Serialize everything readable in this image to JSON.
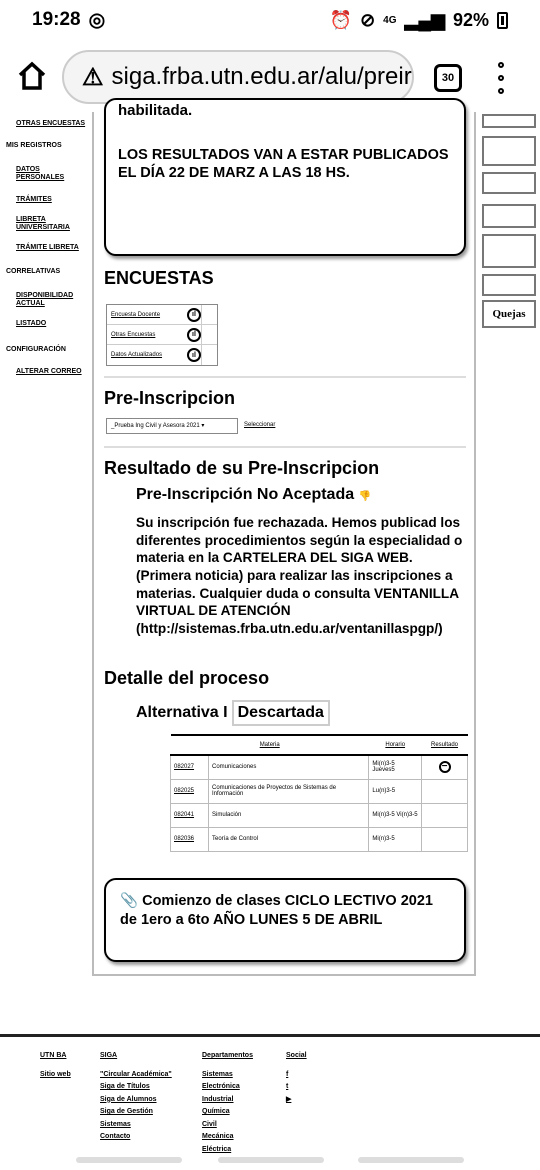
{
  "status": {
    "time": "19:28",
    "battery": "92%",
    "signal": "4G"
  },
  "browser": {
    "url": "siga.frba.utn.edu.ar/alu/preir",
    "tab_count": "30"
  },
  "sidebar": {
    "items": [
      {
        "label": "OTRAS ENCUESTAS"
      },
      {
        "label": "MIS REGISTROS"
      },
      {
        "label": "DATOS PERSONALES"
      },
      {
        "label": "TRÁMITES"
      },
      {
        "label": "LIBRETA UNIVERSITARIA"
      },
      {
        "label": "TRÁMITE LIBRETA"
      },
      {
        "label": "CORRELATIVAS"
      },
      {
        "label": "DISPONIBILIDAD ACTUAL"
      },
      {
        "label": "LISTADO"
      },
      {
        "label": "CONFIGURACIÓN"
      },
      {
        "label": "ALTERAR CORREO"
      }
    ]
  },
  "notice": {
    "top_line": "habilitada.",
    "results": "LOS RESULTADOS VAN A ESTAR PUBLICADOS EL DÍA 22 DE MARZ A LAS 18 HS."
  },
  "encuestas": {
    "title": "ENCUESTAS",
    "rows": [
      "Encuesta Docente",
      "Otras Encuestas",
      "Datos Actualizados"
    ]
  },
  "preinscripcion": {
    "title": "Pre-Inscripcion",
    "select_value": "_Prueba Ing Civil y Asesora 2021",
    "select_link": "Seleccionar"
  },
  "resultado": {
    "title": "Resultado de su Pre-Inscripcion",
    "status_title": "Pre-Inscripción No Aceptada",
    "body": "Su inscripción fue rechazada. Hemos publicad los diferentes procedimientos según la especialidad o materia en la CARTELERA DEL SIGA WEB. (Primera noticia) para realizar las inscripciones a materias. Cualquier duda o consulta VENTANILLA VIRTUAL DE ATENCIÓN (http://sistemas.frba.utn.edu.ar/ventanillaspgp/)"
  },
  "detalle": {
    "title": "Detalle del proceso",
    "alt_label": "Alternativa I",
    "alt_status": "Descartada",
    "table": {
      "headers": [
        "Materia",
        "Horario",
        "Resultado"
      ],
      "rows": [
        {
          "code": "082027",
          "name": "Comunicaciones",
          "schedule": "Mi(n)3-5 Jueves5",
          "result": "−"
        },
        {
          "code": "082025",
          "name": "Comunicaciones de Proyectos de Sistemas de Información",
          "schedule": "Lu(n)3-5",
          "result": ""
        },
        {
          "code": "082041",
          "name": "Simulación",
          "schedule": "Mi(n)3-5 Vi(n)3-5",
          "result": ""
        },
        {
          "code": "082036",
          "name": "Teoría de Control",
          "schedule": "Mi(n)3-5",
          "result": ""
        }
      ]
    }
  },
  "clases": {
    "text": "Comienzo de clases CICLO LECTIVO 2021 de 1ero a 6to AÑO LUNES 5 DE ABRIL"
  },
  "badges": [
    "",
    "",
    "",
    "",
    "",
    "",
    "Quejas"
  ],
  "footer": {
    "cols": [
      {
        "head": "UTN BA",
        "items": [
          "Sitio web"
        ]
      },
      {
        "head": "SIGA",
        "items": [
          "\"Circular Académica\"",
          "Siga de Títulos",
          "Siga de Alumnos",
          "Siga de Gestión",
          "Sistemas",
          "Contacto"
        ]
      },
      {
        "head": "Departamentos",
        "items": [
          "Sistemas",
          "Electrónica",
          "Industrial",
          "Química",
          "Civil",
          "Mecánica",
          "Eléctrica"
        ]
      },
      {
        "head": "Social",
        "items": [
          "f",
          "t",
          ""
        ]
      }
    ]
  }
}
